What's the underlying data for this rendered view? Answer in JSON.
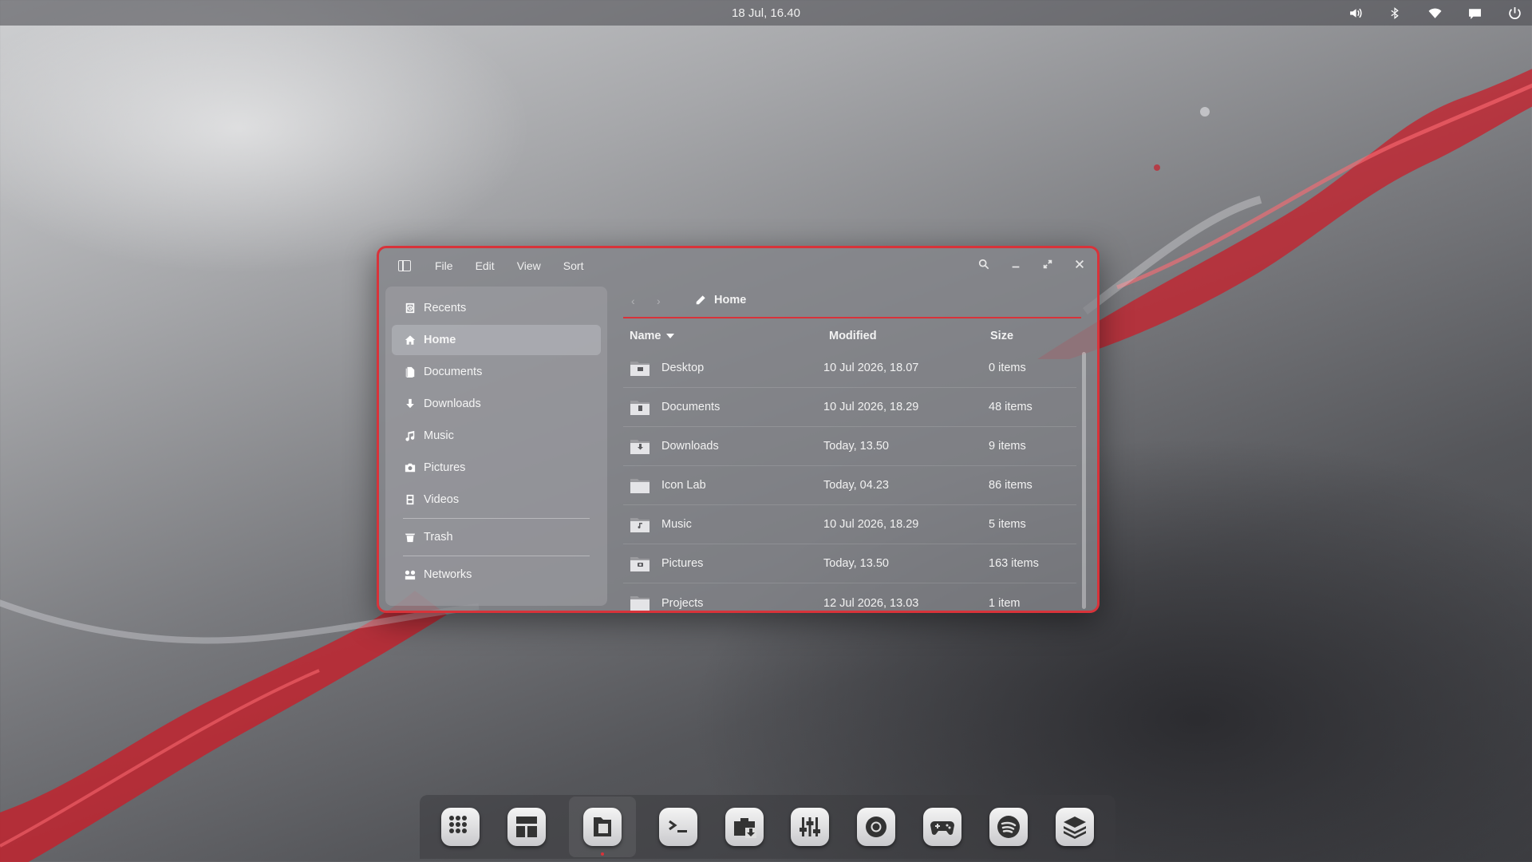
{
  "topbar": {
    "clock": "18 Jul, 16.40",
    "tray_icons": [
      "volume-icon",
      "bluetooth-icon",
      "wifi-icon",
      "chat-icon",
      "power-icon"
    ]
  },
  "window": {
    "accent_color": "#d8333a",
    "menu": [
      "File",
      "Edit",
      "View",
      "Sort"
    ],
    "breadcrumb": "Home",
    "sidebar": {
      "items": [
        {
          "label": "Recents",
          "icon": "clock-icon"
        },
        {
          "label": "Home",
          "icon": "home-icon",
          "active": true
        },
        {
          "label": "Documents",
          "icon": "document-icon"
        },
        {
          "label": "Downloads",
          "icon": "download-icon"
        },
        {
          "label": "Music",
          "icon": "music-icon"
        },
        {
          "label": "Pictures",
          "icon": "camera-icon"
        },
        {
          "label": "Videos",
          "icon": "film-icon"
        }
      ],
      "trash": "Trash",
      "networks": "Networks"
    },
    "columns": {
      "name": "Name",
      "modified": "Modified",
      "size": "Size"
    },
    "files": [
      {
        "name": "Desktop",
        "modified": "10 Jul 2026, 18.07",
        "size": "0 items"
      },
      {
        "name": "Documents",
        "modified": "10 Jul 2026, 18.29",
        "size": "48 items"
      },
      {
        "name": "Downloads",
        "modified": "Today, 13.50",
        "size": "9 items"
      },
      {
        "name": "Icon Lab",
        "modified": "Today, 04.23",
        "size": "86 items"
      },
      {
        "name": "Music",
        "modified": "10 Jul 2026, 18.29",
        "size": "5 items"
      },
      {
        "name": "Pictures",
        "modified": "Today, 13.50",
        "size": "163 items"
      },
      {
        "name": "Projects",
        "modified": "12 Jul 2026, 13.03",
        "size": "1 item"
      }
    ]
  },
  "dock": {
    "apps": [
      "app-grid-icon",
      "workspace-icon",
      "files-icon",
      "terminal-icon",
      "package-installer-icon",
      "mixer-icon",
      "chrome-icon",
      "gamepad-icon",
      "spotify-icon",
      "stack-icon"
    ],
    "active_app": "files-icon"
  }
}
